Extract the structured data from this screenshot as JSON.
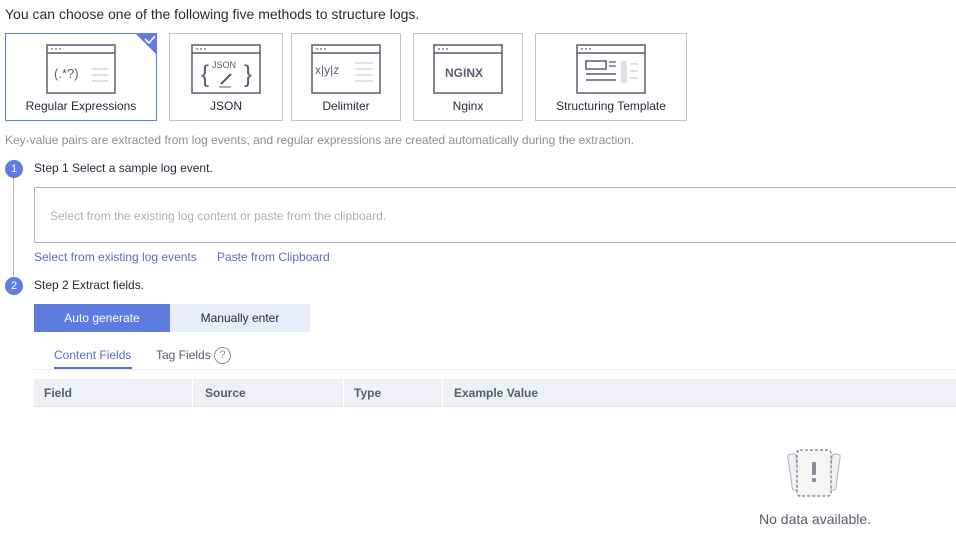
{
  "intro": "You can choose one of the following five methods to structure logs.",
  "methods": [
    {
      "label": "Regular Expressions",
      "icon": "regex-icon",
      "icon_text": "(.*?)",
      "selected": true
    },
    {
      "label": "JSON",
      "icon": "json-icon",
      "icon_text": "JSON",
      "selected": false
    },
    {
      "label": "Delimiter",
      "icon": "delimiter-icon",
      "icon_text": "x|y|z",
      "selected": false
    },
    {
      "label": "Nginx",
      "icon": "nginx-icon",
      "icon_text": "NGINX",
      "selected": false
    },
    {
      "label": "Structuring Template",
      "icon": "template-icon",
      "selected": false
    }
  ],
  "description": "Key-value pairs are extracted from log events, and regular expressions are created automatically during the extraction.",
  "step1": {
    "number": "1",
    "title": "Step 1 Select a sample log event.",
    "placeholder": "Select from the existing log content or paste from the clipboard.",
    "link_select": "Select from existing log events",
    "link_paste": "Paste from Clipboard"
  },
  "step2": {
    "number": "2",
    "title": "Step 2 Extract fields.",
    "auto_label": "Auto generate",
    "manual_label": "Manually enter",
    "tabs": [
      "Content Fields",
      "Tag Fields"
    ],
    "help_glyph": "?",
    "columns": [
      "Field",
      "Source",
      "Type",
      "Example Value"
    ],
    "empty_text": "No data available."
  },
  "colors": {
    "accent": "#5e7ce0",
    "link": "#526ecc",
    "header_bg": "#eef0f5"
  }
}
